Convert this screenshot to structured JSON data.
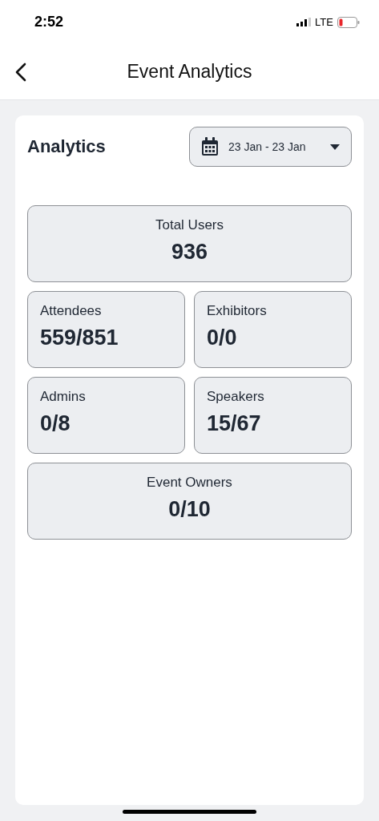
{
  "status_bar": {
    "time": "2:52",
    "network": "LTE"
  },
  "nav": {
    "title": "Event Analytics"
  },
  "analytics": {
    "heading": "Analytics",
    "date_range": "23 Jan - 23 Jan",
    "stats": [
      {
        "kind": "wide",
        "label": "Total Users",
        "value": "936"
      },
      {
        "kind": "half",
        "label": "Attendees",
        "value": "559/851"
      },
      {
        "kind": "half",
        "label": "Exhibitors",
        "value": "0/0"
      },
      {
        "kind": "half",
        "label": "Admins",
        "value": "0/8"
      },
      {
        "kind": "half",
        "label": "Speakers",
        "value": "15/67"
      },
      {
        "kind": "wide",
        "label": "Event Owners",
        "value": "0/10"
      }
    ]
  }
}
